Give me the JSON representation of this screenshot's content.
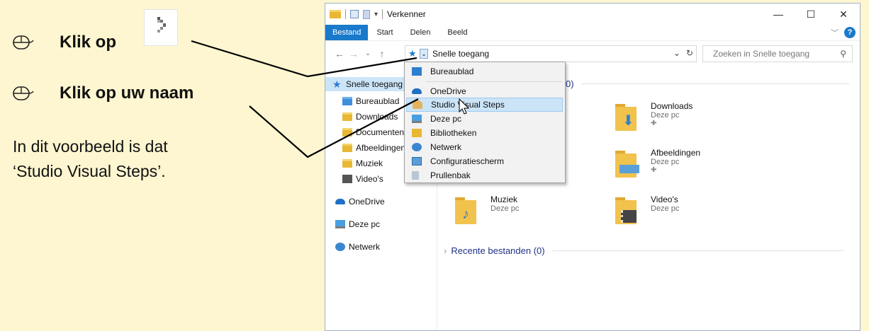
{
  "instructions": {
    "step1": "Klik op",
    "step2": "Klik op uw naam",
    "note_line1": "In dit voorbeeld is dat",
    "note_line2": "‘Studio Visual Steps’."
  },
  "window": {
    "title": "Verkenner",
    "ribbon_tabs": [
      "Bestand",
      "Start",
      "Delen",
      "Beeld"
    ],
    "address": "Snelle toegang",
    "search_placeholder": "Zoeken in Snelle toegang"
  },
  "nav_pane": [
    {
      "label": "Snelle toegang",
      "icon": "star-icon",
      "selected": true
    },
    {
      "label": "Bureaublad",
      "icon": "folder-icon"
    },
    {
      "label": "Downloads",
      "icon": "download-folder-icon"
    },
    {
      "label": "Documenten",
      "icon": "documents-folder-icon"
    },
    {
      "label": "Afbeeldingen",
      "icon": "pictures-folder-icon"
    },
    {
      "label": "Muziek",
      "icon": "music-folder-icon"
    },
    {
      "label": "Video's",
      "icon": "video-folder-icon"
    },
    {
      "label": "OneDrive",
      "icon": "onedrive-icon"
    },
    {
      "label": "Deze pc",
      "icon": "pc-icon"
    },
    {
      "label": "Netwerk",
      "icon": "network-icon"
    }
  ],
  "dropdown": [
    {
      "label": "Bureaublad",
      "icon": "desktop-icon"
    },
    {
      "label": "OneDrive",
      "icon": "onedrive-icon"
    },
    {
      "label": "Studio Visual Steps",
      "icon": "user-icon",
      "highlighted": true
    },
    {
      "label": "Deze pc",
      "icon": "pc-icon"
    },
    {
      "label": "Bibliotheken",
      "icon": "libraries-icon"
    },
    {
      "label": "Netwerk",
      "icon": "network-icon"
    },
    {
      "label": "Configuratiescherm",
      "icon": "control-panel-icon"
    },
    {
      "label": "Prullenbak",
      "icon": "recycle-bin-icon"
    }
  ],
  "content": {
    "frequent_suffix": "0)",
    "tiles": [
      {
        "name": "Downloads",
        "sub": "Deze pc",
        "pinned": true
      },
      {
        "name": "Afbeeldingen",
        "sub": "Deze pc",
        "pinned": true
      },
      {
        "name": "Muziek",
        "sub": "Deze pc",
        "pinned": false
      },
      {
        "name": "Video's",
        "sub": "Deze pc",
        "pinned": false
      }
    ],
    "recent_header": "Recente bestanden (0)"
  },
  "colors": {
    "page_bg": "#fdf6d0",
    "accent": "#1979ca",
    "header_text": "#1e3287",
    "highlight": "#cce4f7"
  }
}
